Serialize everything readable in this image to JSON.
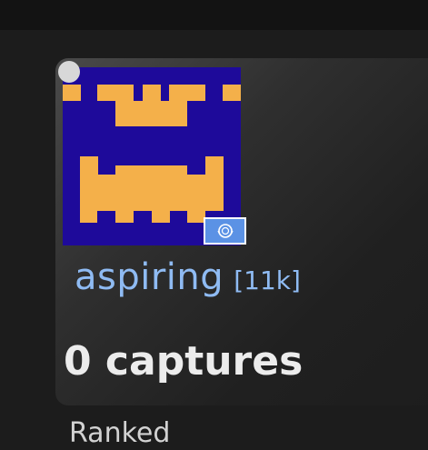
{
  "player": {
    "username": "aspiring",
    "rating": "[11k]",
    "captures": "0 captures",
    "game_type": "Ranked",
    "avatar_icon": "pixel-castle-avatar-icon",
    "flag_icon": "un-flag-icon"
  },
  "colors": {
    "avatar_background": "#1e0a9a",
    "avatar_foreground": "#f4b04a",
    "username": "#8fbbf3",
    "flag_background": "#5b92e5"
  }
}
